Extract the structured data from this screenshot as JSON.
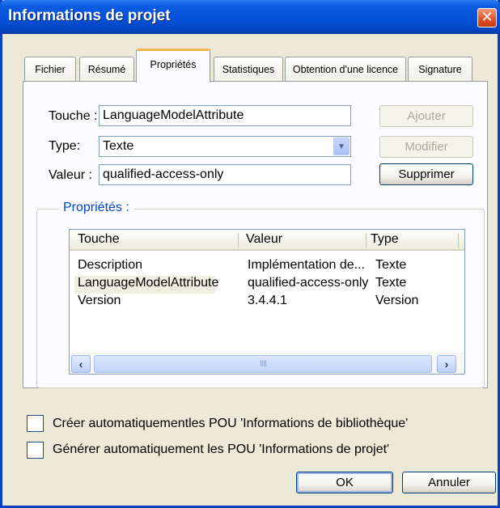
{
  "window": {
    "title": "Informations de projet",
    "close_icon": "✕"
  },
  "tabs": [
    {
      "label": "Fichier"
    },
    {
      "label": "Résumé"
    },
    {
      "label": "Propriétés",
      "active": true
    },
    {
      "label": "Statistiques"
    },
    {
      "label": "Obtention d'une licence"
    },
    {
      "label": "Signature"
    }
  ],
  "form": {
    "key_label": "Touche :",
    "key_value": "LanguageModelAttribute",
    "type_label": "Type:",
    "type_value": "Texte",
    "value_label": "Valeur :",
    "value_value": "qualified-access-only"
  },
  "buttons": {
    "add": "Ajouter",
    "modify": "Modifier",
    "delete": "Supprimer",
    "ok": "OK",
    "cancel": "Annuler"
  },
  "properties": {
    "group_title": "Propriétés :",
    "columns": [
      "Touche",
      "Valeur",
      "Type"
    ],
    "rows": [
      {
        "key": "Description",
        "value": "Implémentation de...",
        "type": "Texte"
      },
      {
        "key": "LanguageModelAttribute",
        "value": "qualified-access-only",
        "type": "Texte"
      },
      {
        "key": "Version",
        "value": "3.4.4.1",
        "type": "Version"
      }
    ],
    "scroll_left_icon": "‹",
    "scroll_right_icon": "›",
    "scroll_thumb_grip": "IIII"
  },
  "options": {
    "auto_library_pou": "Créer automatiquementles POU 'Informations de bibliothèque'",
    "auto_project_pou": "Générer automatiquement les POU  'Informations de projet'"
  },
  "colors": {
    "titlebar": "#0552d8",
    "active_tab_accent": "#f7b74a",
    "group_title": "#0046d5",
    "dialog_bg": "#ece9d8"
  }
}
